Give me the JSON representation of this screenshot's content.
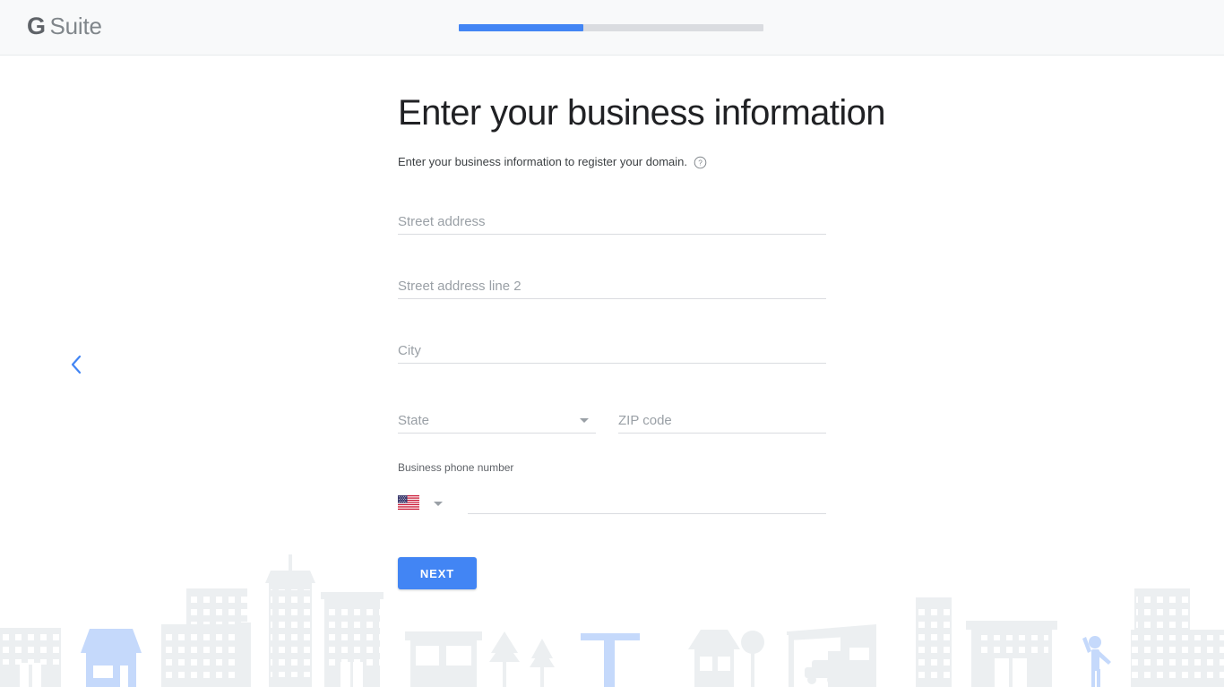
{
  "header": {
    "brand_g": "G",
    "brand_name": "Suite",
    "progress_percent": 41
  },
  "nav": {
    "back_label": "Back",
    "back_icon": "chevron-left-icon"
  },
  "main": {
    "title": "Enter your business information",
    "subtitle": "Enter your business information to register your domain.",
    "help_icon": "help-circle-icon",
    "fields": [
      {
        "name": "street-address",
        "placeholder": "Street address",
        "value": ""
      },
      {
        "name": "street-address-2",
        "placeholder": "Street address line 2",
        "value": ""
      },
      {
        "name": "city",
        "placeholder": "City",
        "value": ""
      }
    ],
    "state": {
      "placeholder": "State",
      "value": "",
      "caret_icon": "chevron-down-icon"
    },
    "zip": {
      "placeholder": "ZIP code",
      "value": ""
    },
    "phone": {
      "label": "Business phone number",
      "country_icon": "us-flag-icon",
      "caret_icon": "chevron-down-icon",
      "value": "",
      "placeholder": ""
    },
    "next_label": "NEXT"
  },
  "illustration": {
    "name": "city-skyline-illustration",
    "description": "Light gray city skyline with blue accent shop, signpost and person"
  },
  "colors": {
    "accent_blue": "#4285f4",
    "header_bg": "#f8f9fa",
    "title_text": "#202124",
    "placeholder_text": "#9aa0a6",
    "field_line": "#dadce0",
    "progress_track": "#dadce0",
    "illustration_gray": "#eceff1",
    "illustration_blue": "#c5d9fb"
  }
}
